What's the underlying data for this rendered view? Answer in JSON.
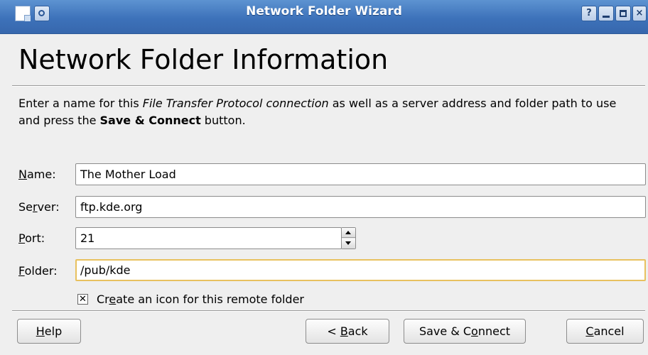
{
  "window": {
    "title": "Network Folder Wizard",
    "help_button": "?",
    "close_button": "×"
  },
  "heading": "Network Folder Information",
  "description": {
    "part1": "Enter a name for this ",
    "protocol": "File Transfer Protocol connection",
    "part2": " as well as a server address and folder path to use and press the ",
    "button_ref": "Save & Connect",
    "part3": " button."
  },
  "form": {
    "name": {
      "label_mnemonic": "N",
      "label_rest": "ame:",
      "value": "The Mother Load"
    },
    "server": {
      "label_pre": "Se",
      "label_mnemonic": "r",
      "label_rest": "ver:",
      "value": "ftp.kde.org"
    },
    "port": {
      "label_mnemonic": "P",
      "label_rest": "ort:",
      "value": "21"
    },
    "folder": {
      "label_mnemonic": "F",
      "label_rest": "older:",
      "value": "/pub/kde"
    },
    "create_icon": {
      "label_pre": "Cr",
      "label_mnemonic": "e",
      "label_rest": "ate an icon for this remote folder",
      "checked_mark": "✕"
    }
  },
  "buttons": {
    "help": {
      "mnemonic": "H",
      "rest": "elp"
    },
    "back": {
      "pre": "< ",
      "mnemonic": "B",
      "rest": "ack"
    },
    "save": {
      "pre": "Save & C",
      "mnemonic": "o",
      "rest": "nnect"
    },
    "cancel": {
      "mnemonic": "C",
      "rest": "ancel"
    }
  },
  "colors": {
    "titlebar": "#3d72ba",
    "focus_border": "#e8c15f",
    "background": "#efefef"
  }
}
